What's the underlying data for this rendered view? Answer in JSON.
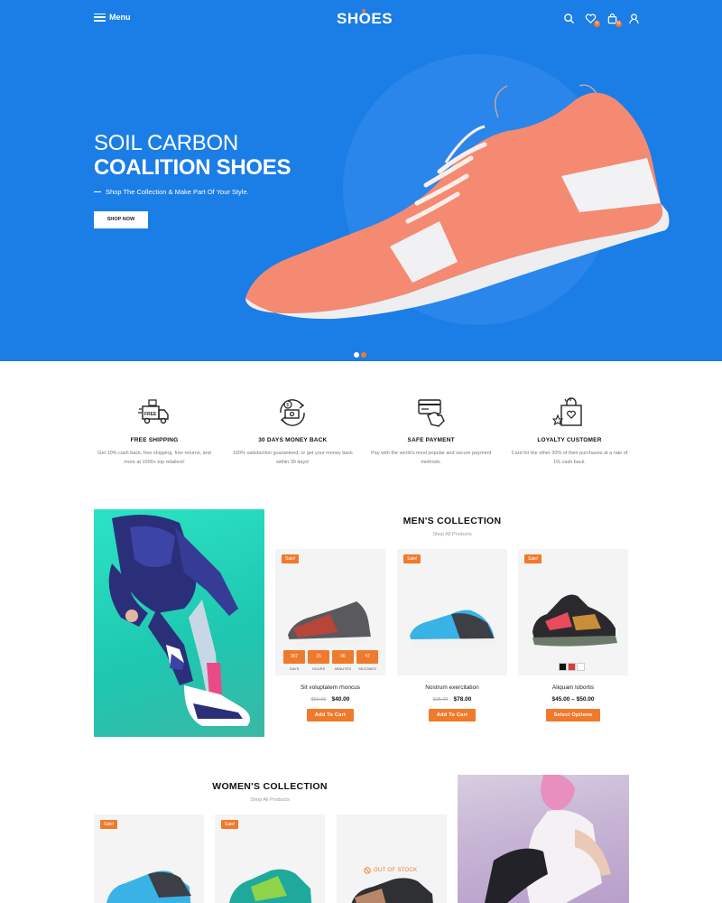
{
  "header": {
    "menu_label": "Menu",
    "logo": {
      "before": "SH",
      "o": "O",
      "after": "ES"
    },
    "wishlist_count": "0",
    "cart_count": "0"
  },
  "hero": {
    "title_line1": "SOIL CARBON",
    "title_line2": "COALITION SHOES",
    "subtitle": "Shop The Collection & Make Part Of Your Style.",
    "button_label": "SHOP NOW",
    "slides": 2,
    "active_slide": 2
  },
  "features": [
    {
      "icon": "free-shipping-truck-icon",
      "title": "FREE SHIPPING",
      "text": "Get 10% cash back, free shipping, free returns, and more at 1000+ top retailers!"
    },
    {
      "icon": "money-back-icon",
      "title": "30 DAYS MONEY BACK",
      "text": "100% satisfaction guaranteed, or get your money back within 30 days!"
    },
    {
      "icon": "safe-payment-card-icon",
      "title": "SAFE PAYMENT",
      "text": "Pay with the world's most popular and secure payment methods."
    },
    {
      "icon": "loyalty-gift-bag-icon",
      "title": "LOYALTY CUSTOMER",
      "text": "Card for the other 30% of their purchases at a rate of 1% cash back."
    }
  ],
  "men": {
    "title": "MEN'S COLLECTION",
    "subtitle": "Shop All Products",
    "products": [
      {
        "badge": "Sale!",
        "name": "Sit voluptatem rhoncus",
        "old_price": "$50.00",
        "price": "$40.00",
        "button": "Add To Cart",
        "countdown": [
          {
            "value": "367",
            "label": "DAYS"
          },
          {
            "value": "15",
            "label": "HOURS"
          },
          {
            "value": "06",
            "label": "MINUTES"
          },
          {
            "value": "47",
            "label": "SECONDS"
          }
        ]
      },
      {
        "badge": "Sale!",
        "name": "Nostrum exercitation",
        "old_price": "$95.00",
        "price": "$78.00",
        "button": "Add To Cart"
      },
      {
        "badge": "Sale!",
        "name": "Aliquam lobortis",
        "old_price": "",
        "price": "$45.00 – $50.00",
        "button": "Select Options",
        "swatches": [
          "#111111",
          "#d93a3a",
          "#ffffff"
        ]
      }
    ]
  },
  "women": {
    "title": "WOMEN'S COLLECTION",
    "subtitle": "Shop All Products",
    "products": [
      {
        "badge": "Sale!"
      },
      {
        "badge": "Sale!"
      },
      {
        "status": "OUT OF STOCK"
      }
    ]
  },
  "colors": {
    "brand_blue": "#1b7de6",
    "accent_orange": "#f07a2c"
  }
}
